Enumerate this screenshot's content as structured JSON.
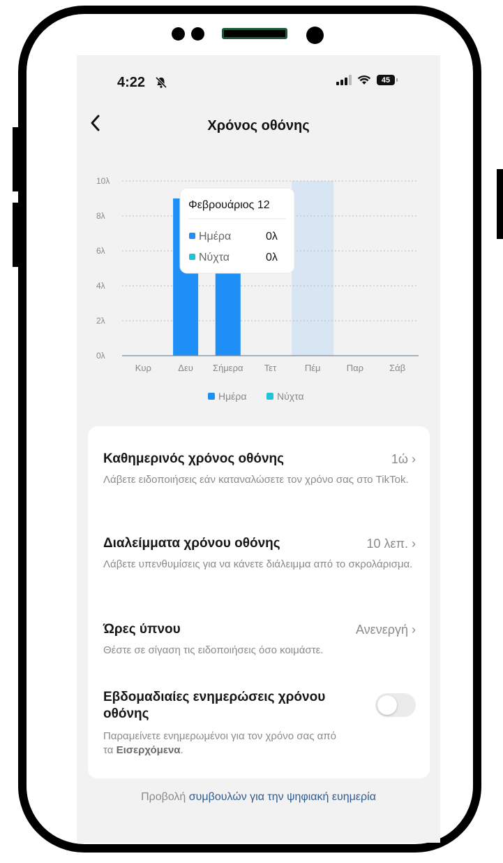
{
  "status_bar": {
    "time": "4:22",
    "battery": "45",
    "bell_icon": "bell-slash-icon",
    "signal_icon": "signal-icon",
    "wifi_icon": "wifi-icon"
  },
  "header": {
    "back_icon": "chevron-left-icon",
    "title": "Χρόνος οθόνης"
  },
  "colors": {
    "day": "#1e8ff7",
    "night": "#22c3d7",
    "highlight": "#d8e6f3",
    "link": "#2f5b8e"
  },
  "chart_data": {
    "type": "bar",
    "categories": [
      "Κυρ",
      "Δευ",
      "Σήμερα",
      "Τετ",
      "Πέμ",
      "Παρ",
      "Σάβ"
    ],
    "series": [
      {
        "name": "Ημέρα",
        "values": [
          0,
          9,
          8.2,
          0,
          0,
          0,
          0
        ]
      },
      {
        "name": "Νύχτα",
        "values": [
          0,
          0,
          0,
          0,
          0,
          0,
          0
        ]
      }
    ],
    "y_ticks": [
      "0λ",
      "2λ",
      "4λ",
      "6λ",
      "8λ",
      "10λ"
    ],
    "y_tick_values": [
      0,
      2,
      4,
      6,
      8,
      10
    ],
    "ylim": [
      0,
      10
    ],
    "highlighted_category": "Πέμ",
    "legend": [
      "Ημέρα",
      "Νύχτα"
    ],
    "legend_position": "bottom",
    "grid": true,
    "tooltip": {
      "title": "Φεβρουάριος 12",
      "rows": [
        {
          "label": "Ημέρα",
          "value": "0λ"
        },
        {
          "label": "Νύχτα",
          "value": "0λ"
        }
      ]
    }
  },
  "settings": {
    "daily": {
      "title": "Καθημερινός χρόνος οθόνης",
      "value": "1ώ",
      "desc": "Λάβετε ειδοποιήσεις εάν καταναλώσετε τον χρόνο σας στο TikTok."
    },
    "breaks": {
      "title": "Διαλείμματα χρόνου οθόνης",
      "value": "10 λεπ.",
      "desc": "Λάβετε υπενθυμίσεις για να κάνετε διάλειμμα από το σκρολάρισμα."
    },
    "sleep": {
      "title": "Ώρες ύπνου",
      "value": "Ανενεργή",
      "desc": "Θέστε σε σίγαση τις ειδοποιήσεις όσο κοιμάστε."
    },
    "weekly": {
      "title": "Εβδομαδιαίες ενημερώσεις χρόνου οθόνης",
      "desc_prefix": "Παραμείνετε ενημερωμένοι για τον χρόνο σας από τα ",
      "desc_bold": "Εισερχόμενα",
      "desc_suffix": ".",
      "enabled": false
    }
  },
  "footer": {
    "prefix": "Προβολή ",
    "link": "συμβουλών για την ψηφιακή ευημερία"
  }
}
